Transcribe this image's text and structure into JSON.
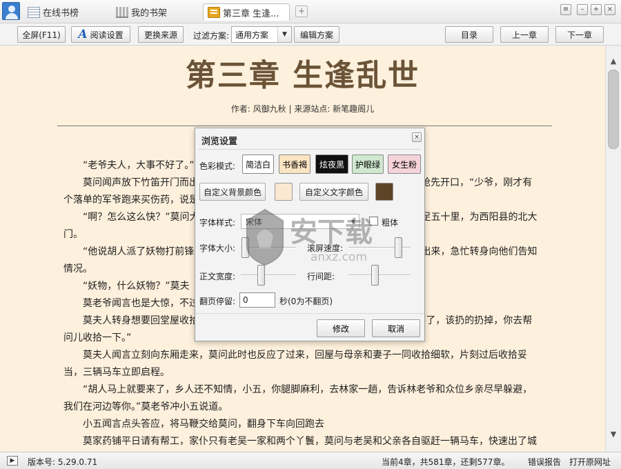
{
  "tabs": {
    "online": "在线书榜",
    "shelf": "我的书架",
    "active": "第三章 生逢..."
  },
  "toolbar": {
    "fullscreen": "全屏(F11)",
    "reading_settings": "阅读设置",
    "change_source": "更换来源",
    "filter_label": "过滤方案:",
    "filter_value": "通用方案",
    "edit_scheme": "编辑方案",
    "toc": "目录",
    "prev": "上一章",
    "next": "下一章"
  },
  "chapter": {
    "title": "第三章  生逢乱世",
    "meta": "作者: 风御九秋 | 来源站点: 新笔趣阁儿"
  },
  "content": {
    "paragraphs": [
      "“老爷夫人，大事不好了。”",
      "莫问闻声放下竹笛开门而出，来到院中，见报信的是家仆老吴，尚未开口，老吴抢先开口，“少爷，刚才有个落单的军爷跑来买伤药，说是胡",
      "“啊？怎么这么快？”莫问大惊，北面的吕梁山离此不过百里，这里距离县城也不足五十里，为西阳县的北大门。",
      "“他说胡人派了妖物打前锋，见人就杀……”这时莫老爷和莫夫人闻声从正屋走了出来，急忙转身向他们告知情况。",
      "“妖物，什么妖物？”莫夫",
      "莫老爷闻言也是大惊，不过很快镇定下来，吩咐道：“赶紧收拾细软，马上走！”",
      "莫夫人转身想要回堂屋收拾，莫老爷又道：“别收拾太多，只拿贵重的，别的不要了，该扔的扔掉，你去帮问儿收拾一下。”",
      "莫夫人闻言立刻向东厢走来，莫问此时也反应了过来，回屋与母亲和妻子一同收拾细软，片刻过后收拾妥当，三辆马车立即启程。",
      "“胡人马上就要来了，乡人还不知情，小五，你腿脚麻利，去林家一趟，告诉林老爷和众位乡亲尽早躲避，我们在河边等你。”莫老爷冲小五说道。",
      "小五闻言点头答应，将马鞭交给莫问，翻身下车向回跑去",
      "莫家药铺平日请有帮工，家仆只有老吴一家和两个丫鬟，莫问与老吴和父亲各自驱赶一辆马车，快速出了城"
    ]
  },
  "status": {
    "version": "版本号: 5.29.0.71",
    "progress": "当前4章，共581章，还剩577章。",
    "report": "错误报告",
    "open_url": "打开原网址"
  },
  "dialog": {
    "title": "浏览设置",
    "color_mode_label": "色彩模式:",
    "modes": {
      "simple_white": "简洁白",
      "book_brown": "书香褐",
      "night_black": "炫夜黑",
      "eye_green": "护眼绿",
      "girl_pink": "女生粉"
    },
    "custom_bg": "自定义背景颜色",
    "custom_text": "自定义文字颜色",
    "font_style_label": "字体样式:",
    "font_value": "宋体",
    "bold_label": "粗体",
    "font_size_label": "字体大小:",
    "scroll_speed_label": "滚屏速度:",
    "text_width_label": "正文宽度:",
    "line_spacing_label": "行间距:",
    "page_turn_label": "翻页停留:",
    "page_turn_value": "0",
    "page_turn_unit": "秒(0为不翻页)",
    "ok": "修改",
    "cancel": "取消",
    "font_size_level": 0.02,
    "scroll_speed_level": 0.85,
    "text_width_level": 0.35,
    "line_spacing_level": 0.42
  },
  "colors": {
    "reader_bg": "#fdf0dc",
    "title_color": "#6b5337",
    "custom_bg_swatch": "#fbe8d1",
    "custom_text_swatch": "#5e4427",
    "mode_white": "#ffffff",
    "mode_brown": "#fbe4c2",
    "mode_black": "#101010",
    "mode_green": "#cfe8cf",
    "mode_pink": "#f6d3da"
  },
  "watermark": {
    "text": "安下载",
    "sub": "anxz.com"
  }
}
